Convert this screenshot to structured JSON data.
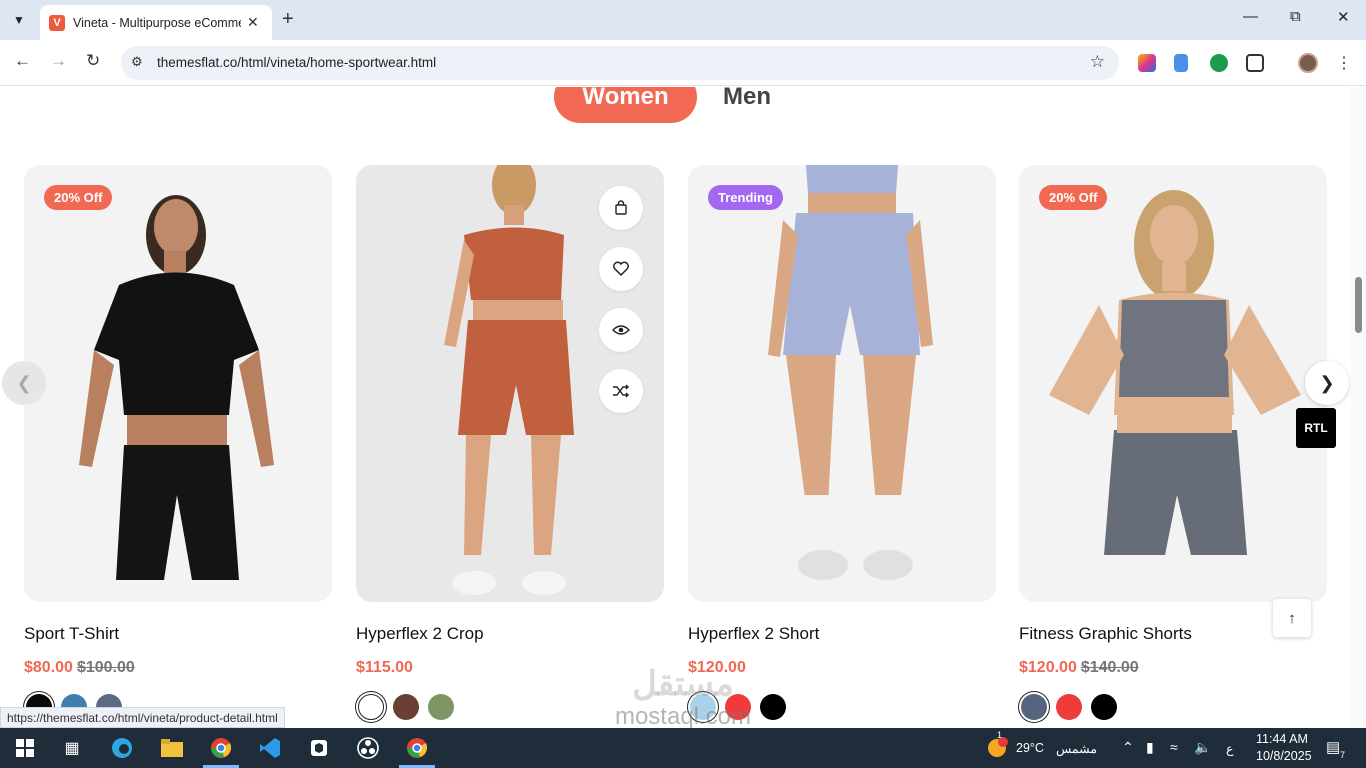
{
  "browser": {
    "tab_title": "Vineta - Multipurpose eComme",
    "favicon_letter": "V",
    "url": "themesflat.co/html/vineta/home-sportwear.html",
    "status_url": "https://themesflat.co/html/vineta/product-detail.html"
  },
  "page": {
    "tabs": {
      "women": "Women",
      "men": "Men"
    },
    "rtl_label": "RTL",
    "products": [
      {
        "name": "Sport T-Shirt",
        "price": "$80.00",
        "old_price": "$100.00",
        "badge": "20% Off",
        "swatches": [
          "#0a0a0a",
          "#3e7fad",
          "#5d6a86"
        ]
      },
      {
        "name": "Hyperflex 2 Crop",
        "price": "$115.00",
        "old_price": "",
        "badge": "",
        "swatches": [
          "#ffffff",
          "#6b4034",
          "#7f9564"
        ]
      },
      {
        "name": "Hyperflex 2 Short",
        "price": "$120.00",
        "old_price": "",
        "badge": "Trending",
        "swatches": [
          "#a9d2ea",
          "#f03b3b",
          "#000000"
        ]
      },
      {
        "name": "Fitness Graphic Shorts",
        "price": "$120.00",
        "old_price": "$140.00",
        "badge": "20% Off",
        "swatches": [
          "#56657d",
          "#f03b3b",
          "#000000"
        ]
      }
    ]
  },
  "watermark": {
    "arabic": "مستقل",
    "latin": "mostaql.com"
  },
  "taskbar": {
    "temperature": "29°C",
    "weather_text": "مشمس",
    "language": "ع",
    "time": "11:44 AM",
    "date": "10/8/2025",
    "weather_badge": "1",
    "notification_count": "7"
  }
}
